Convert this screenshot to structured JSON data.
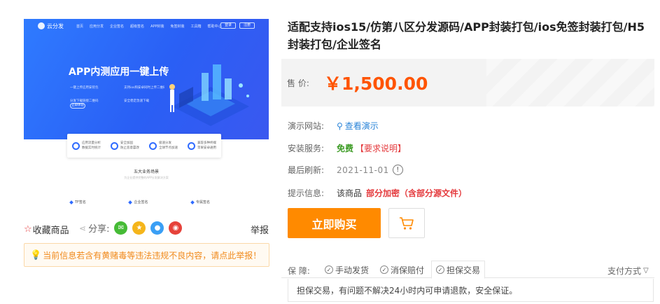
{
  "preview": {
    "brand": "云分发",
    "nav": [
      "首页",
      "应用分发",
      "企业签名",
      "超级签名",
      "APP封装",
      "免签封装",
      "工具箱",
      "帮助中心"
    ],
    "nav_buttons": [
      "登录",
      "注册"
    ],
    "hero_title": "APP内测应用一键上传",
    "hero_features": [
      "一键上传应用安装包",
      "支持ios和安卓同时上传二维码",
      "分发下载链接二维码",
      "安全稳定急速下载"
    ],
    "hero_more": "立即体验",
    "cards": [
      {
        "title": "应用流量分析",
        "sub": "数据实时统计"
      },
      {
        "title": "安全加固",
        "sub": "防止恶意篡改"
      },
      {
        "title": "极速分发",
        "sub": "全球节点加速"
      },
      {
        "title": "兼容多种终端",
        "sub": "苹果安卓通用"
      }
    ],
    "section_title": "五大业务场景",
    "section_sub": "为企业提供完整的APP分发解决方案",
    "tabs": [
      "TF签名",
      "企业签名",
      "专属签名"
    ]
  },
  "actions": {
    "favorite": "收藏商品",
    "share_label": "分享:",
    "report": "举报"
  },
  "share_colors": {
    "wechat": "#46bb36",
    "qzone": "#f5b51b",
    "qq": "#3a9ff5",
    "weibo": "#e6423a"
  },
  "warning": "当前信息若含有黄赌毒等违法违规不良内容，请点此举报！",
  "product": {
    "title": "适配支持ios15/仿第八区分发源码/APP封装打包/ios免签封装打包/H5封装打包/企业签名",
    "price_label": "售 价:",
    "price": "￥1,500.00"
  },
  "details": {
    "demo_label": "演示网站:",
    "demo_link": "查看演示",
    "install_label": "安装服务:",
    "install_value": "免费",
    "install_note": "【要求说明】",
    "refresh_label": "最后刷新:",
    "refresh_date": "2021-11-01",
    "hint_label": "提示信息:",
    "hint_prefix": "该商品",
    "hint_value": "部分加密（含部分源文件）"
  },
  "buttons": {
    "buy": "立即购买"
  },
  "guarantee": {
    "label": "保 障:",
    "tags": [
      "手动发货",
      "消保赔付",
      "担保交易"
    ],
    "payment": "支付方式",
    "description": "担保交易，有问题不解决24小时内可申请退款，安全保证。"
  }
}
